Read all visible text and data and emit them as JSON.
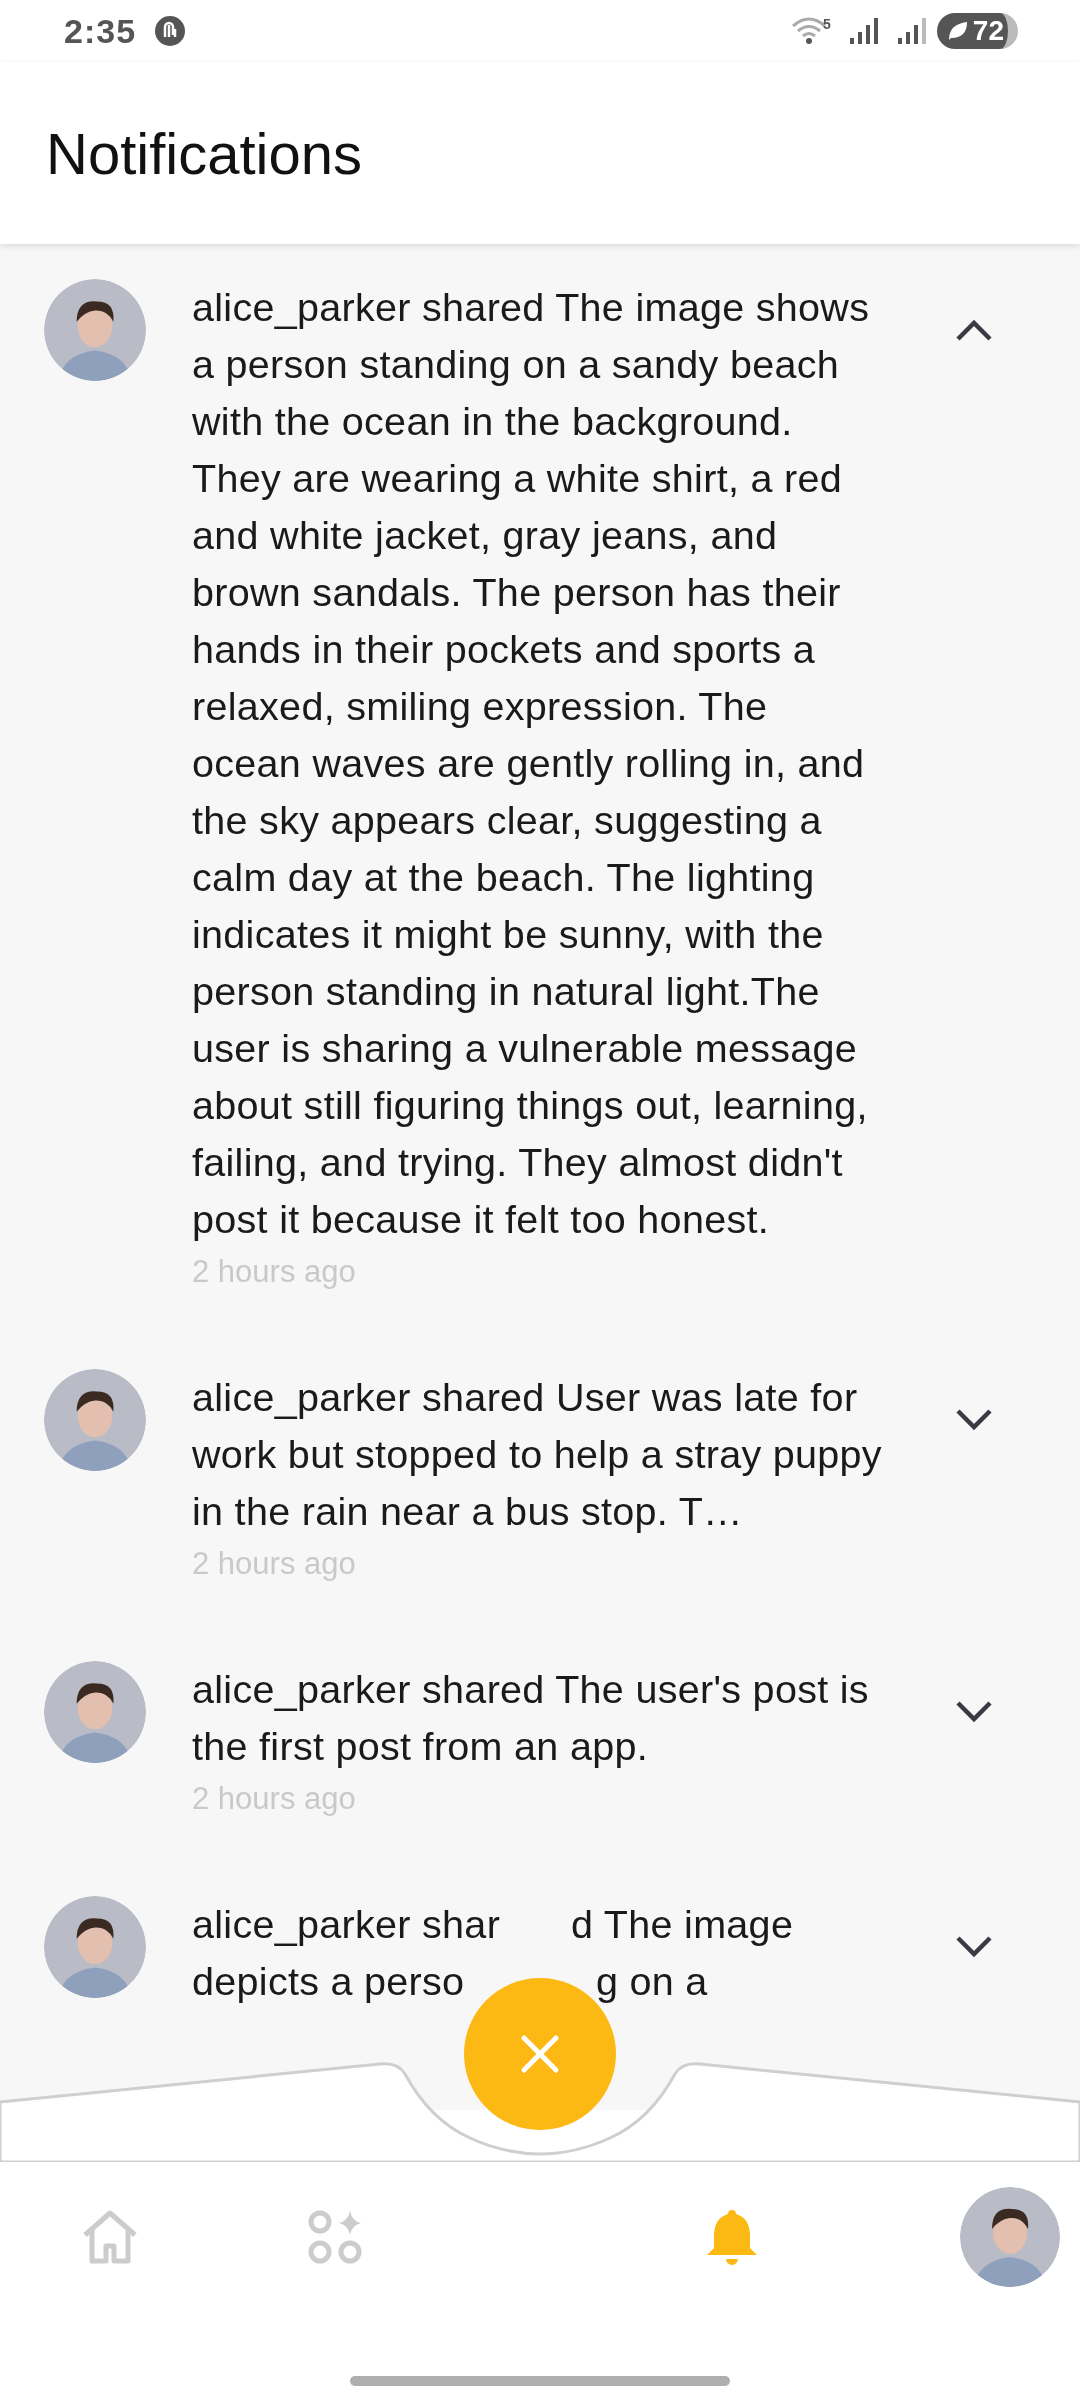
{
  "status_bar": {
    "time": "2:35",
    "wifi_badge": "5",
    "battery": "72"
  },
  "header": {
    "title": "Notifications"
  },
  "notifications": [
    {
      "text": "alice_parker shared The image shows a person standing on a sandy beach with the ocean in the background. They are wearing a white shirt, a red and white jacket, gray jeans, and brown sandals. The person has their hands in their pockets and sports a relaxed, smiling expression. The ocean waves are gently rolling in, and the sky appears clear, suggesting a calm day at the beach. The lighting indicates it might be sunny, with the person standing in natural light.The user is sharing a vulnerable message about still figuring things out, learning, failing, and trying. They almost didn't post it because it felt too honest.",
      "time": "2 hours ago",
      "expanded": true
    },
    {
      "text": "alice_parker shared User was late for work but stopped to help a stray puppy in the rain near a bus stop. T…",
      "time": "2 hours ago",
      "expanded": false
    },
    {
      "text": "alice_parker shared The user's post is the first post from an app.",
      "time": "2 hours ago",
      "expanded": false
    },
    {
      "visible_lines": [
        [
          "alice_parker shar",
          "d The image"
        ],
        [
          "depicts a perso",
          "g on a"
        ]
      ],
      "expanded": false
    }
  ],
  "bottom_nav": {
    "items": [
      {
        "kind": "home",
        "selected": false
      },
      {
        "kind": "apps",
        "selected": false
      },
      {
        "kind": "bell",
        "selected": true
      },
      {
        "kind": "avatar",
        "selected": false
      }
    ]
  }
}
